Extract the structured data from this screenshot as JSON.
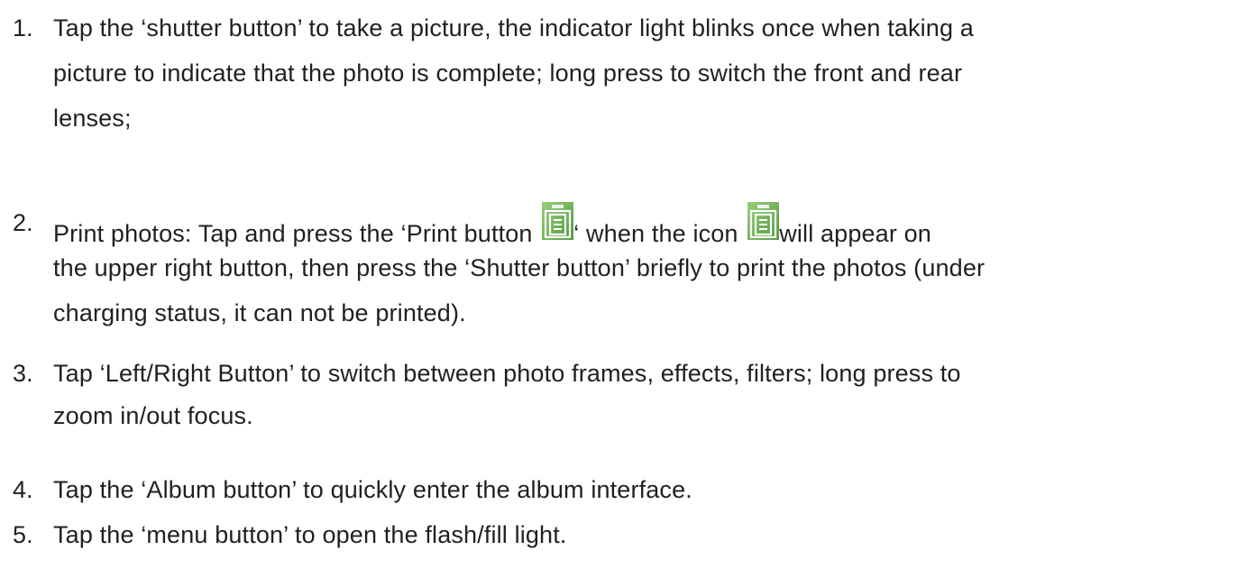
{
  "items": [
    {
      "number": "1.",
      "lines": [
        "Tap the ‘shutter button’ to take a picture, the indicator light blinks once when taking a",
        "picture to indicate that the photo is complete; long press to switch the front and rear",
        "lenses;"
      ]
    },
    {
      "number": "2.",
      "line1_part1": "Print photos: Tap and press the ‘Print button ",
      "line1_part2": "‘ when the icon ",
      "line1_part3": "will appear on",
      "lines_rest": [
        "the upper right button, then press the ‘Shutter button’ briefly to print the photos (under",
        "charging status, it can not be printed)."
      ],
      "icon": "print-icon"
    },
    {
      "number": "3.",
      "lines": [
        "Tap ‘Left/Right Button’ to switch between photo frames, effects, filters; long press to",
        "zoom in/out focus."
      ]
    },
    {
      "number": "4.",
      "lines": [
        "Tap the ‘Album button’ to quickly enter the album interface."
      ]
    },
    {
      "number": "5.",
      "lines": [
        "Tap the ‘menu button’ to open the flash/fill light."
      ]
    }
  ],
  "colors": {
    "text": "#231f20",
    "icon_bg": "#6fae57",
    "icon_fg": "#ffffff"
  }
}
